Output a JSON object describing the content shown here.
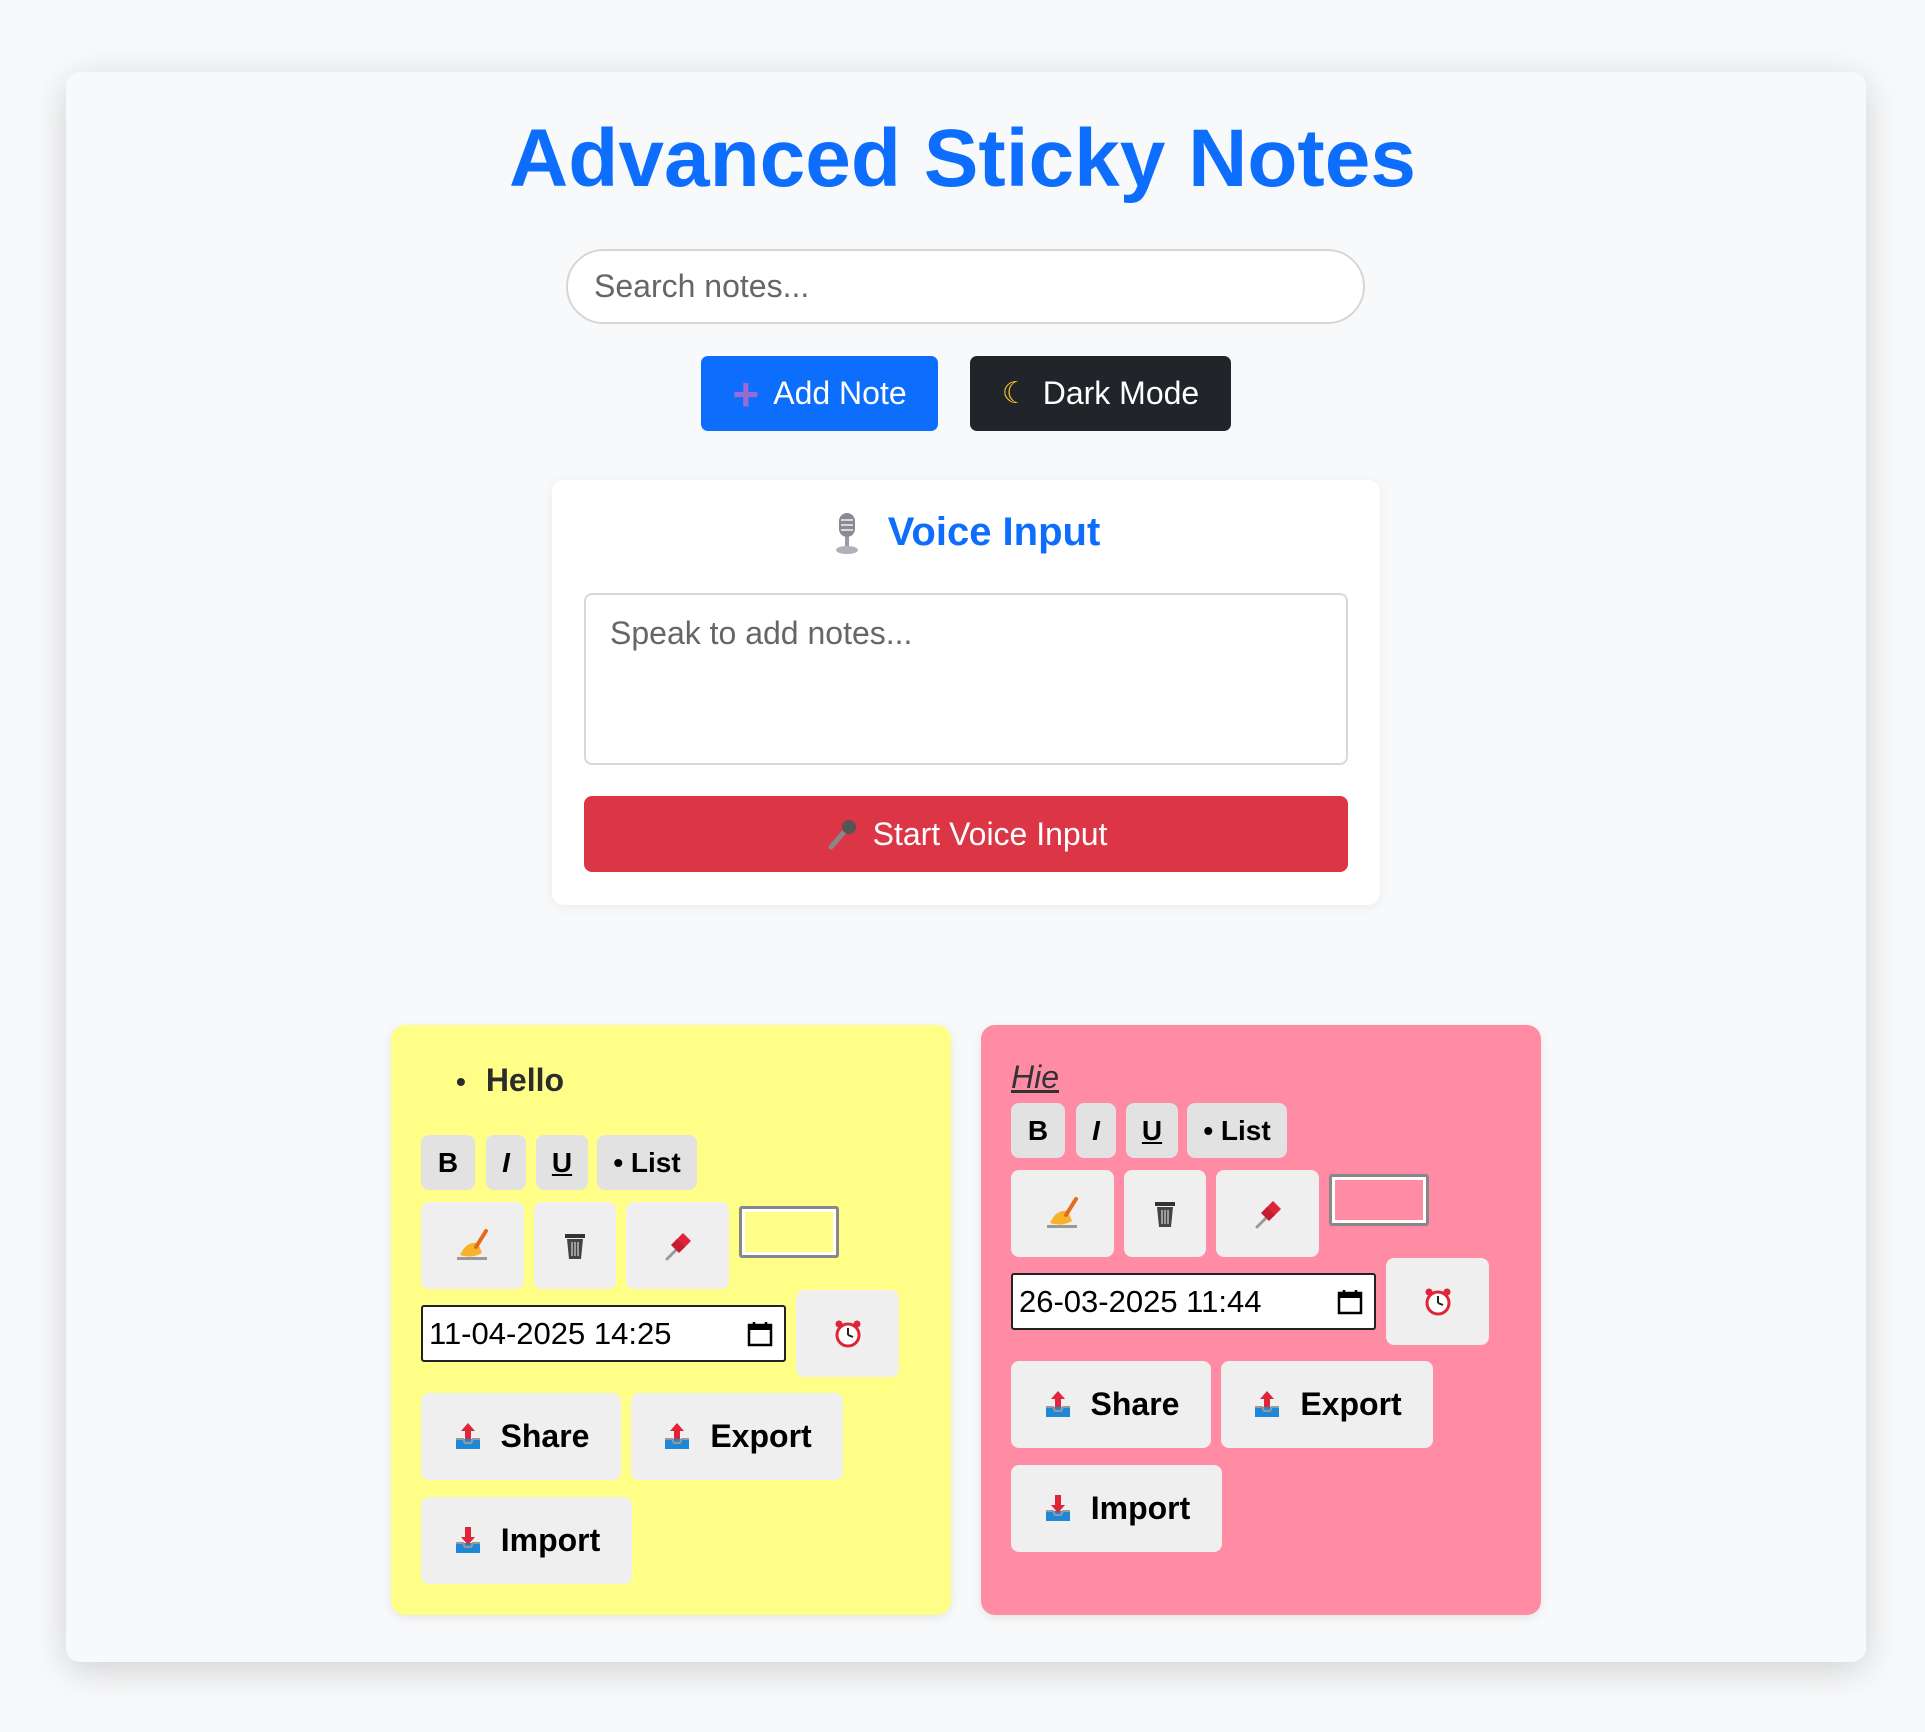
{
  "header": {
    "title": "Advanced Sticky Notes"
  },
  "search": {
    "placeholder": "Search notes..."
  },
  "toolbar": {
    "add_label": "Add Note",
    "dark_label": "Dark Mode"
  },
  "voice": {
    "title": "Voice Input",
    "placeholder": "Speak to add notes...",
    "button_label": "Start Voice Input"
  },
  "format_labels": {
    "bold": "B",
    "italic": "I",
    "underline": "U",
    "list": "• List"
  },
  "action_labels": {
    "share": "Share",
    "export": "Export",
    "import": "Import"
  },
  "notes": [
    {
      "text": "Hello",
      "color": "#ffff88",
      "datetime": "11-04-2025 14:25"
    },
    {
      "text": "Hie",
      "color": "#ff8ba4",
      "datetime": "26-03-2025 11:44"
    }
  ],
  "colors": {
    "accent": "#0d6efd",
    "danger": "#dc3545",
    "dark": "#212529"
  }
}
